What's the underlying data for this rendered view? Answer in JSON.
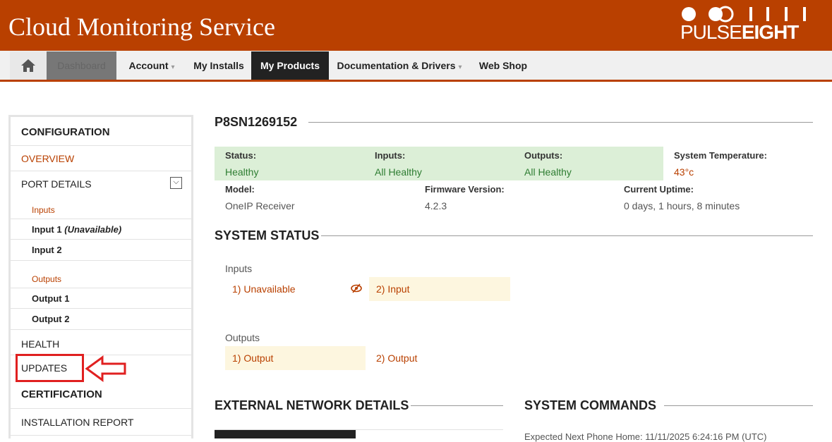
{
  "header": {
    "app_title": "Cloud Monitoring Service",
    "logo_text_a": "PULSE",
    "logo_text_b": "EIGHT",
    "brand_color": "#b94000"
  },
  "nav": {
    "home_icon": "home-icon",
    "items": [
      {
        "label": "Dashboard"
      },
      {
        "label": "Account",
        "caret": "▾"
      },
      {
        "label": "My Installs"
      },
      {
        "label": "My Products"
      },
      {
        "label": "Documentation & Drivers",
        "caret": "▾"
      },
      {
        "label": "Web Shop"
      }
    ]
  },
  "sidebar": {
    "configuration": "CONFIGURATION",
    "overview": "OVERVIEW",
    "port_details": "PORT DETAILS",
    "toggle_glyph": "⌵",
    "inputs_label": "Inputs",
    "input1": "Input 1",
    "input1_note": "(Unavailable)",
    "input2": "Input 2",
    "outputs_label": "Outputs",
    "output1": "Output 1",
    "output2": "Output 2",
    "health": "HEALTH",
    "updates": "UPDATES",
    "certification": "CERTIFICATION",
    "installation_report": "INSTALLATION REPORT"
  },
  "device": {
    "serial": "P8SN1269152",
    "status_label": "Status:",
    "status_value": "Healthy",
    "inputs_label": "Inputs:",
    "inputs_value": "All Healthy",
    "outputs_label": "Outputs:",
    "outputs_value": "All Healthy",
    "temp_label": "System Temperature:",
    "temp_value": "43°c",
    "model_label": "Model:",
    "model_value": "OneIP Receiver",
    "firmware_label": "Firmware Version:",
    "firmware_value": "4.2.3",
    "uptime_label": "Current Uptime:",
    "uptime_value": "0 days, 1 hours, 8 minutes"
  },
  "system_status": {
    "title": "SYSTEM STATUS",
    "inputs_heading": "Inputs",
    "input_ports": [
      "1) Unavailable",
      "2) Input"
    ],
    "outputs_heading": "Outputs",
    "output_ports": [
      "1) Output",
      "2) Output"
    ]
  },
  "external_network": {
    "title": "EXTERNAL NETWORK DETAILS"
  },
  "system_commands": {
    "title": "SYSTEM COMMANDS",
    "next_phone_home": "Expected Next Phone Home: 11/11/2025 6:24:16 PM (UTC)"
  }
}
